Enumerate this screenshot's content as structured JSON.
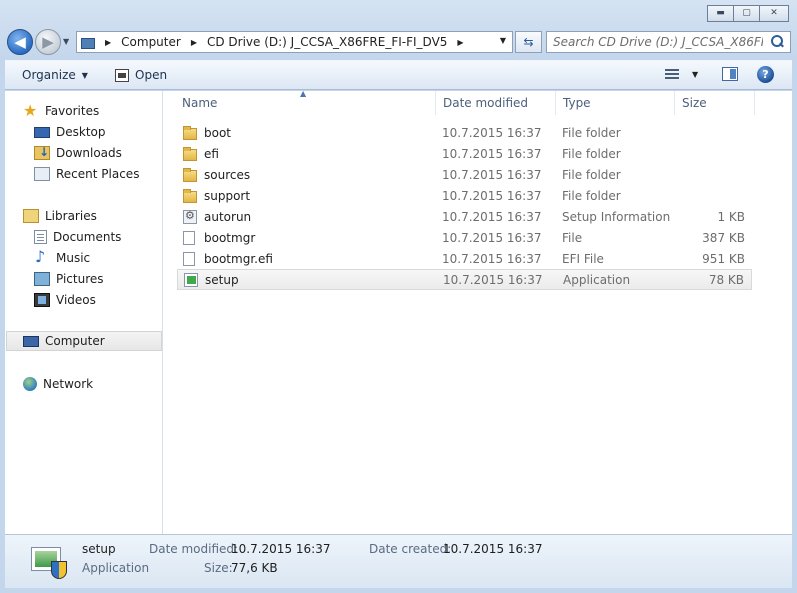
{
  "window": {
    "minimize_glyph": "▬",
    "maximize_glyph": "▢",
    "close_glyph": "✕"
  },
  "nav": {
    "breadcrumbs": [
      "Computer",
      "CD Drive (D:) J_CCSA_X86FRE_FI-FI_DV5"
    ],
    "search_placeholder": "Search CD Drive (D:) J_CCSA_X86FRE_..."
  },
  "toolbar": {
    "organize_label": "Organize",
    "open_label": "Open"
  },
  "sidebar": {
    "favorites_label": "Favorites",
    "favorites": [
      "Desktop",
      "Downloads",
      "Recent Places"
    ],
    "libraries_label": "Libraries",
    "libraries": [
      "Documents",
      "Music",
      "Pictures",
      "Videos"
    ],
    "computer_label": "Computer",
    "network_label": "Network"
  },
  "columns": {
    "name": "Name",
    "date": "Date modified",
    "type": "Type",
    "size": "Size"
  },
  "files": [
    {
      "name": "boot",
      "date": "10.7.2015 16:37",
      "type": "File folder",
      "size": "",
      "icon": "folder-icon"
    },
    {
      "name": "efi",
      "date": "10.7.2015 16:37",
      "type": "File folder",
      "size": "",
      "icon": "folder-icon"
    },
    {
      "name": "sources",
      "date": "10.7.2015 16:37",
      "type": "File folder",
      "size": "",
      "icon": "folder-icon"
    },
    {
      "name": "support",
      "date": "10.7.2015 16:37",
      "type": "File folder",
      "size": "",
      "icon": "folder-icon"
    },
    {
      "name": "autorun",
      "date": "10.7.2015 16:37",
      "type": "Setup Information",
      "size": "1 KB",
      "icon": "setup-information-icon"
    },
    {
      "name": "bootmgr",
      "date": "10.7.2015 16:37",
      "type": "File",
      "size": "387 KB",
      "icon": "file-icon"
    },
    {
      "name": "bootmgr.efi",
      "date": "10.7.2015 16:37",
      "type": "EFI File",
      "size": "951 KB",
      "icon": "file-icon"
    },
    {
      "name": "setup",
      "date": "10.7.2015 16:37",
      "type": "Application",
      "size": "78 KB",
      "icon": "application-icon",
      "selected": true
    }
  ],
  "details": {
    "name": "setup",
    "kind": "Application",
    "date_modified_label": "Date modified:",
    "date_modified": "10.7.2015 16:37",
    "date_created_label": "Date created:",
    "date_created": "10.7.2015 16:37",
    "size_label": "Size:",
    "size": "77,6 KB"
  },
  "colors": {
    "accent": "#2a6cc4",
    "selection": "#ebebeb"
  }
}
